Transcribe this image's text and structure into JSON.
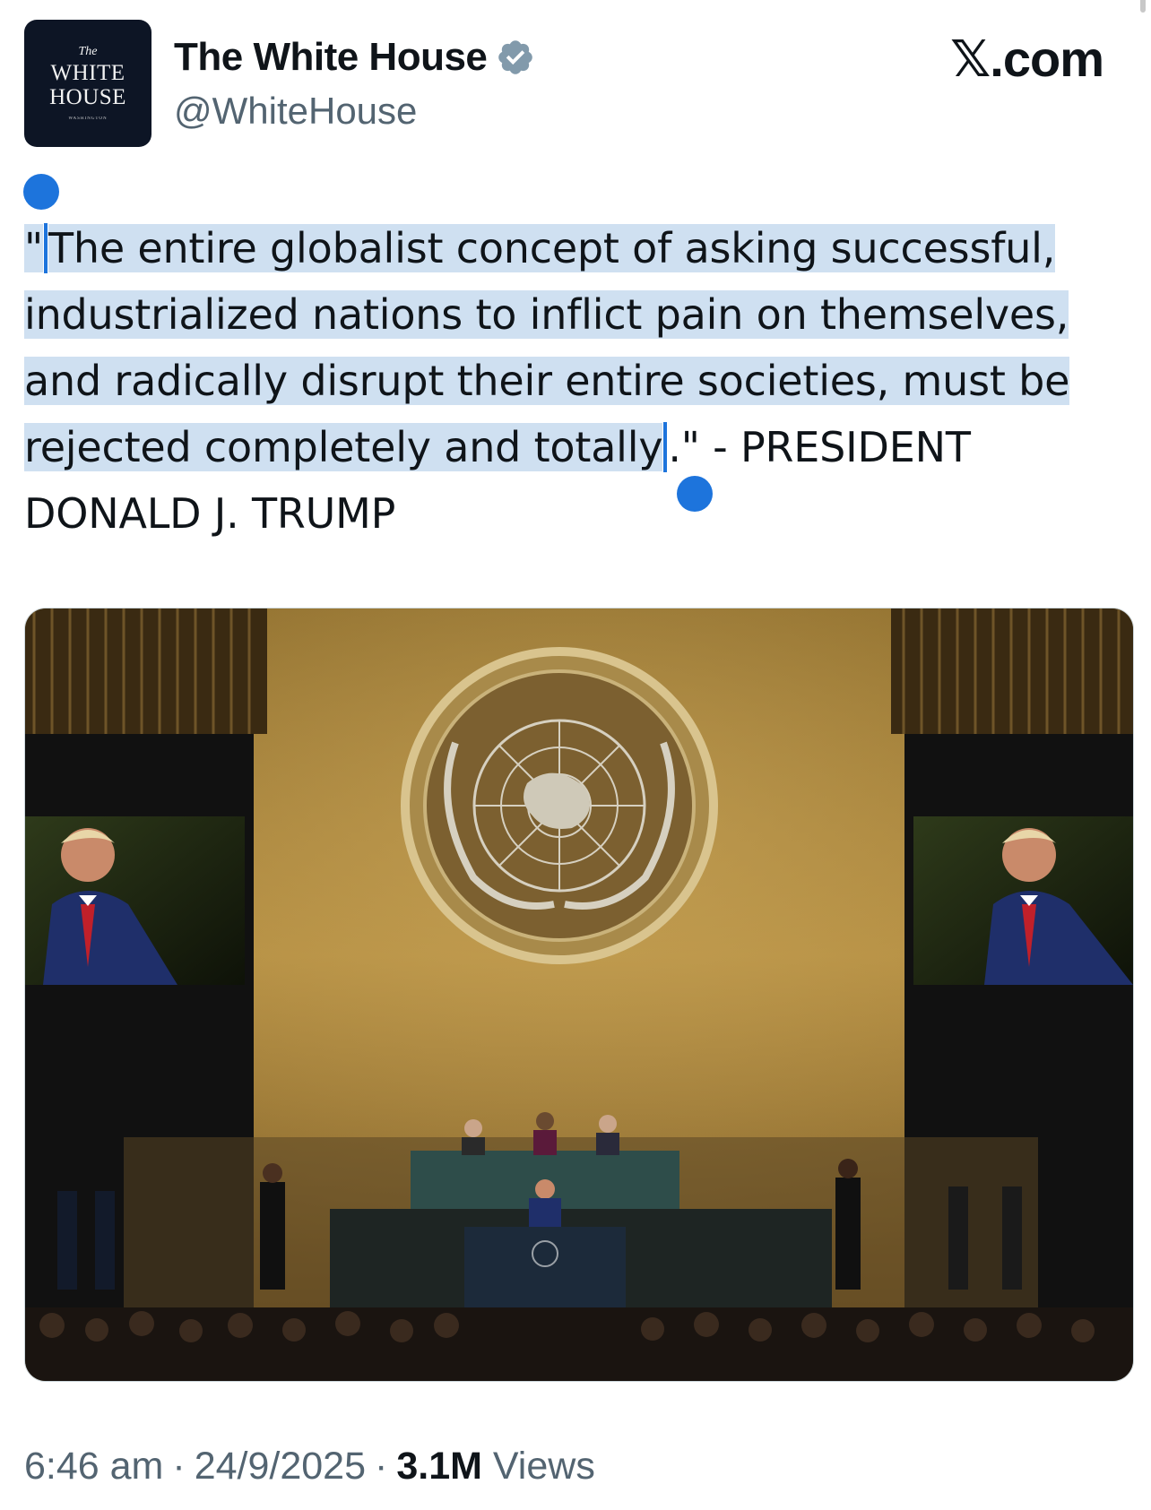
{
  "account": {
    "display_name": "The White House",
    "handle": "@WhiteHouse",
    "verified_icon": "verified-badge-icon",
    "avatar": {
      "line1": "The",
      "line2": "WHITE",
      "line3": "HOUSE",
      "line4": "WASHINGTON"
    }
  },
  "brand": {
    "label": "𝕏.com"
  },
  "tweet": {
    "text_selected_prefix": "\"",
    "text_selected_main": "The entire globalist concept of asking successful, industrialized nations to inflict pain on themselves, and radically disrupt their entire societies, must be rejected completely and totally",
    "text_unselected": ".\" - PRESIDENT DONALD J. TRUMP"
  },
  "media": {
    "alt": "UN General Assembly hall with speaker at podium, large screens showing the speaker, UN emblem on gold wall"
  },
  "meta": {
    "time": "6:46 am",
    "date": "24/9/2025",
    "views_count": "3.1M",
    "views_label": "Views",
    "separator": "·"
  },
  "colors": {
    "selection": "#cfe0f1",
    "selection_handle": "#1d74dc",
    "verified": "#829aab",
    "muted_text": "#536471"
  }
}
